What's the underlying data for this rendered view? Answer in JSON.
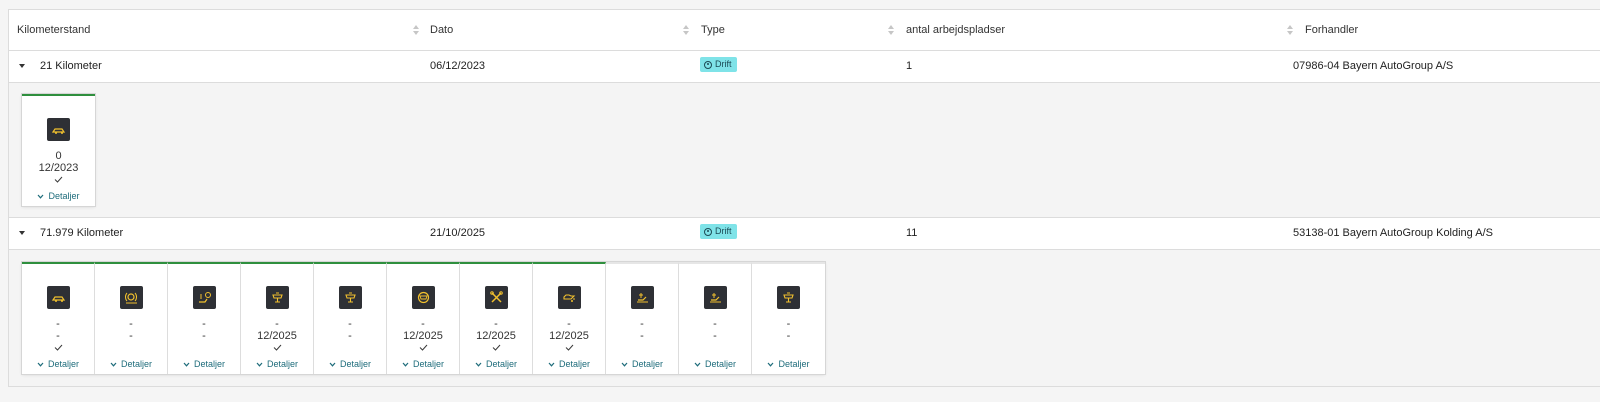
{
  "columns": [
    {
      "label": "Kilometerstand"
    },
    {
      "label": "Dato"
    },
    {
      "label": "Type"
    },
    {
      "label": "antal arbejdspladser"
    },
    {
      "label": "Forhandler"
    }
  ],
  "rows": [
    {
      "mileage": "21 Kilometer",
      "date": "06/12/2023",
      "type": "Drift",
      "workplaces": "1",
      "dealer": "07986-04 Bayern AutoGroup A/S",
      "cards": [
        {
          "icon": "car-icon",
          "line1": "0",
          "line2": "12/2023",
          "checked": true,
          "status": "done",
          "details": "Detaljer"
        }
      ]
    },
    {
      "mileage": "71.979 Kilometer",
      "date": "21/10/2025",
      "type": "Drift",
      "workplaces": "11",
      "dealer": "53138-01 Bayern AutoGroup Kolding A/S",
      "cards": [
        {
          "icon": "car-icon",
          "line1": "-",
          "line2": "-",
          "checked": true,
          "status": "done",
          "details": "Detaljer"
        },
        {
          "icon": "brake-icon",
          "line1": "-",
          "line2": "-",
          "checked": false,
          "status": "done",
          "details": "Detaljer"
        },
        {
          "icon": "brake-fluid-icon",
          "line1": "-",
          "line2": "-",
          "checked": false,
          "status": "done",
          "details": "Detaljer"
        },
        {
          "icon": "service-icon",
          "line1": "-",
          "line2": "12/2025",
          "checked": true,
          "status": "done",
          "details": "Detaljer"
        },
        {
          "icon": "service-icon",
          "line1": "-",
          "line2": "-",
          "checked": false,
          "status": "done",
          "details": "Detaljer"
        },
        {
          "icon": "tire-icon",
          "line1": "-",
          "line2": "12/2025",
          "checked": true,
          "status": "done",
          "details": "Detaljer"
        },
        {
          "icon": "tools-icon",
          "line1": "-",
          "line2": "12/2025",
          "checked": true,
          "status": "done",
          "details": "Detaljer"
        },
        {
          "icon": "oil-icon",
          "line1": "-",
          "line2": "12/2025",
          "checked": true,
          "status": "done",
          "details": "Detaljer"
        },
        {
          "icon": "oil-level-icon",
          "line1": "-",
          "line2": "-",
          "checked": false,
          "status": "pending",
          "details": "Detaljer"
        },
        {
          "icon": "oil-level-icon",
          "line1": "-",
          "line2": "-",
          "checked": false,
          "status": "pending",
          "details": "Detaljer"
        },
        {
          "icon": "service-icon",
          "line1": "-",
          "line2": "-",
          "checked": false,
          "status": "pending",
          "details": "Detaljer"
        }
      ]
    }
  ],
  "colors": {
    "badge_bg": "#7fe3e8",
    "badge_text": "#1c4b55",
    "link": "#1e6c7b",
    "done_accent": "#2f8f3e",
    "icon_bg": "#2e3035",
    "icon_fg": "#f2c12e"
  }
}
